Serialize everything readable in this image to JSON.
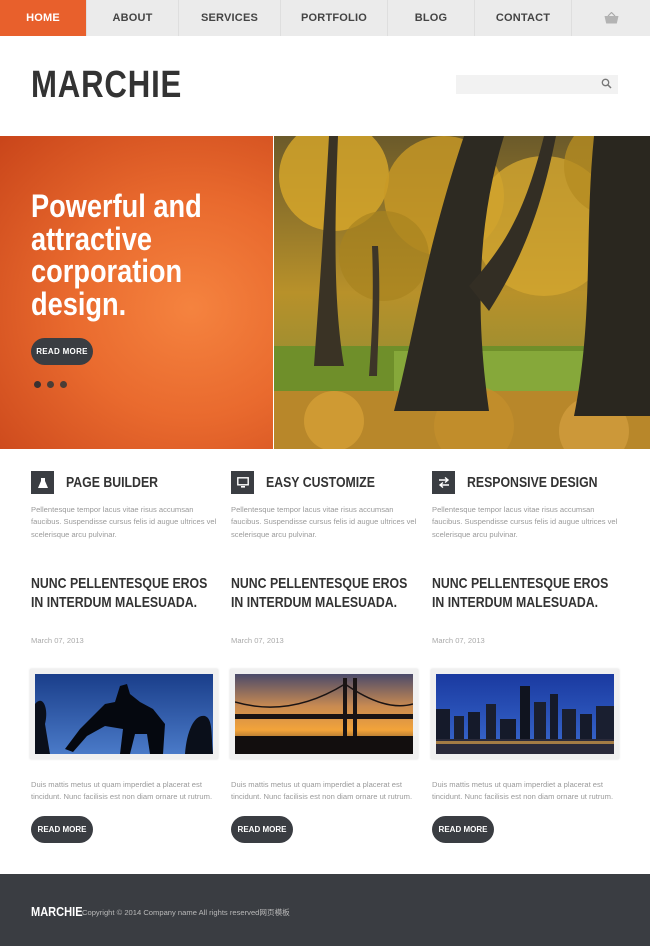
{
  "nav": {
    "items": [
      {
        "label": "HOME"
      },
      {
        "label": "ABOUT"
      },
      {
        "label": "SERVICES"
      },
      {
        "label": "PORTFOLIO"
      },
      {
        "label": "BLOG"
      },
      {
        "label": "CONTACT"
      }
    ],
    "cart_icon": "basket-icon"
  },
  "header": {
    "logo": "MARCHIE",
    "search": {
      "placeholder": "",
      "icon": "search-icon"
    }
  },
  "hero": {
    "title": "Powerful and attractive corporation design.",
    "button": "READ MORE",
    "slides": 3
  },
  "features": [
    {
      "title": "PAGE BUILDER",
      "icon": "flask-icon",
      "text": "Pellentesque tempor lacus vitae risus accumsan faucibus. Suspendisse cursus felis id augue ultrices vel scelerisque arcu pulvinar."
    },
    {
      "title": "EASY CUSTOMIZE",
      "icon": "monitor-icon",
      "text": "Pellentesque tempor lacus vitae risus accumsan faucibus. Suspendisse cursus felis id augue ultrices vel scelerisque arcu pulvinar."
    },
    {
      "title": "RESPONSIVE DESIGN",
      "icon": "swap-arrows-icon",
      "text": "Pellentesque tempor lacus vitae risus accumsan faucibus. Suspendisse cursus felis id augue ultrices vel scelerisque arcu pulvinar."
    }
  ],
  "posts": [
    {
      "title": "NUNC PELLENTESQUE EROS IN INTERDUM MALESUADA.",
      "date": "March 07, 2013",
      "text": "Duis mattis metus ut quam imperdiet a placerat est tincidunt. Nunc facilisis est non diam ornare ut rutrum.",
      "button": "READ MORE"
    },
    {
      "title": "NUNC PELLENTESQUE EROS IN INTERDUM MALESUADA.",
      "date": "March 07, 2013",
      "text": "Duis mattis metus ut quam imperdiet a placerat est tincidunt. Nunc facilisis est non diam ornare ut rutrum.",
      "button": "READ MORE"
    },
    {
      "title": "NUNC PELLENTESQUE EROS IN INTERDUM MALESUADA.",
      "date": "March 07, 2013",
      "text": "Duis mattis metus ut quam imperdiet a placerat est tincidunt. Nunc facilisis est non diam ornare ut rutrum.",
      "button": "READ MORE"
    }
  ],
  "footer": {
    "logo": "MARCHIE",
    "copyright": "Copyright © 2014 Company name All rights reserved网页模板"
  },
  "colors": {
    "accent": "#e8602c",
    "dark": "#3a3d42",
    "nav_bg": "#ebebeb"
  }
}
